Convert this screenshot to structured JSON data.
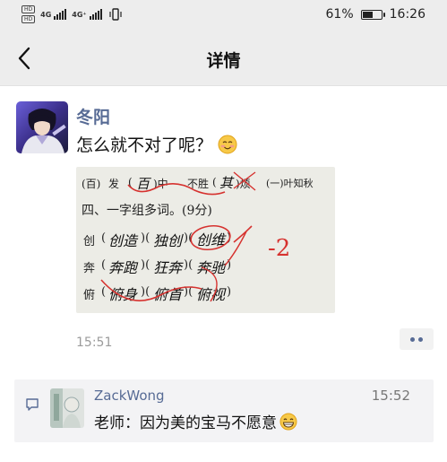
{
  "status_bar": {
    "hd1": "HD",
    "hd2": "HD",
    "net1": "4G",
    "net2": "4G⁺",
    "battery_text": "61%",
    "battery_level": 0.61,
    "time": "16:26"
  },
  "nav": {
    "title": "详情",
    "back_icon": "chevron-left-icon"
  },
  "post": {
    "author": "冬阳",
    "text": "怎么就不对了呢？",
    "emoji": "smiling-face-emoji",
    "time": "15:51",
    "photo": {
      "row1": {
        "p1": "(百)",
        "w1": "发",
        "p2": "(",
        "hw1": "百",
        "p3": ")中",
        "w2": "不胜",
        "p4": "(",
        "hw2": "其",
        "p5": ")烦",
        "w3": "(一)叶知秋"
      },
      "heading": "四、一字组多词。(9分)",
      "rows": [
        {
          "char": "创",
          "a": "创造",
          "b": "独创",
          "c": "创维"
        },
        {
          "char": "奔",
          "a": "奔跑",
          "b": "狂奔",
          "c": "奔驰"
        },
        {
          "char": "俯",
          "a": "俯身",
          "b": "俯首",
          "c": "俯视"
        }
      ],
      "score": "-2"
    },
    "more_icon": "more-dots-icon"
  },
  "comment": {
    "icon": "comment-icon",
    "author": "ZackWong",
    "time": "15:52",
    "text": "老师：因为美的宝马不愿意",
    "emoji": "grinning-face-emoji"
  },
  "colors": {
    "link": "#576b95",
    "bar_bg": "#ededed",
    "comment_bg": "#f3f3f5",
    "red_ink": "#d6322f"
  }
}
